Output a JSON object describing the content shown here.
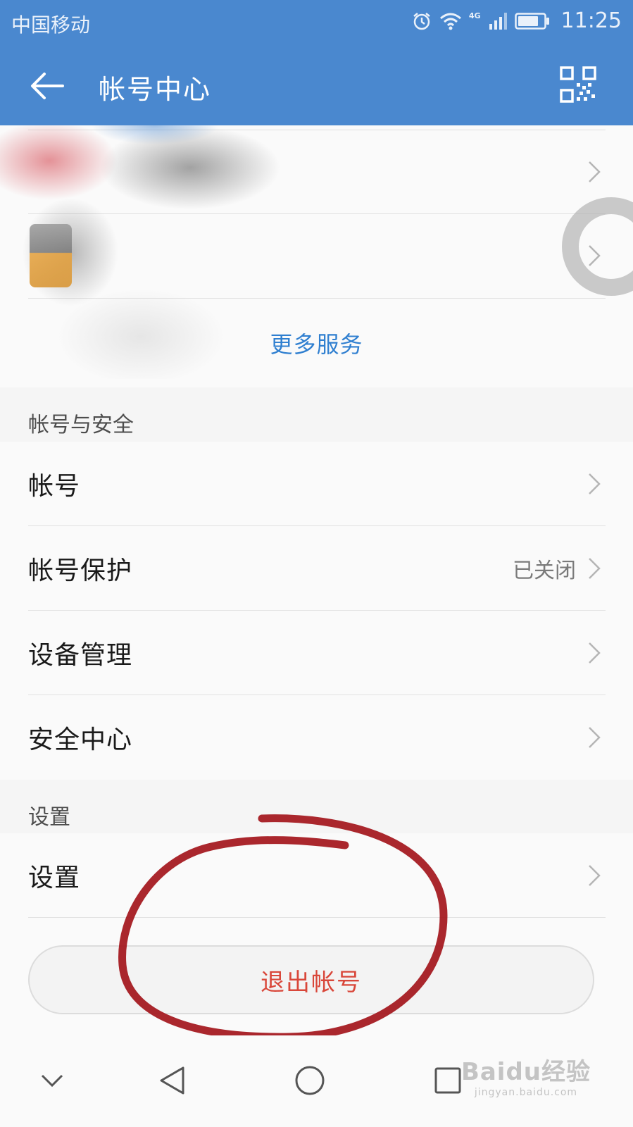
{
  "status_bar": {
    "carrier": "中国移动",
    "network": "4G",
    "time": "11:25",
    "icons": [
      "alarm-icon",
      "wifi-icon",
      "signal-icon",
      "battery-icon"
    ]
  },
  "header": {
    "title": "帐号中心",
    "back_icon": "arrow-left-icon",
    "qr_icon": "qr-code-icon",
    "background": "#4a88cf"
  },
  "services": {
    "more_label": "更多服务"
  },
  "account_security": {
    "header": "帐号与安全",
    "items": [
      {
        "label": "帐号",
        "value": ""
      },
      {
        "label": "帐号保护",
        "value": "已关闭"
      },
      {
        "label": "设备管理",
        "value": ""
      },
      {
        "label": "安全中心",
        "value": ""
      }
    ]
  },
  "settings_section": {
    "header": "设置",
    "items": [
      {
        "label": "设置",
        "value": ""
      }
    ]
  },
  "logout": {
    "label": "退出帐号",
    "color": "#d9473a"
  },
  "nav_bar": {
    "icons": [
      "chevron-down-icon",
      "back-triangle-icon",
      "home-circle-icon",
      "recents-square-icon"
    ]
  },
  "watermark": {
    "main": "Baidu经验",
    "sub": "jingyan.baidu.com"
  }
}
